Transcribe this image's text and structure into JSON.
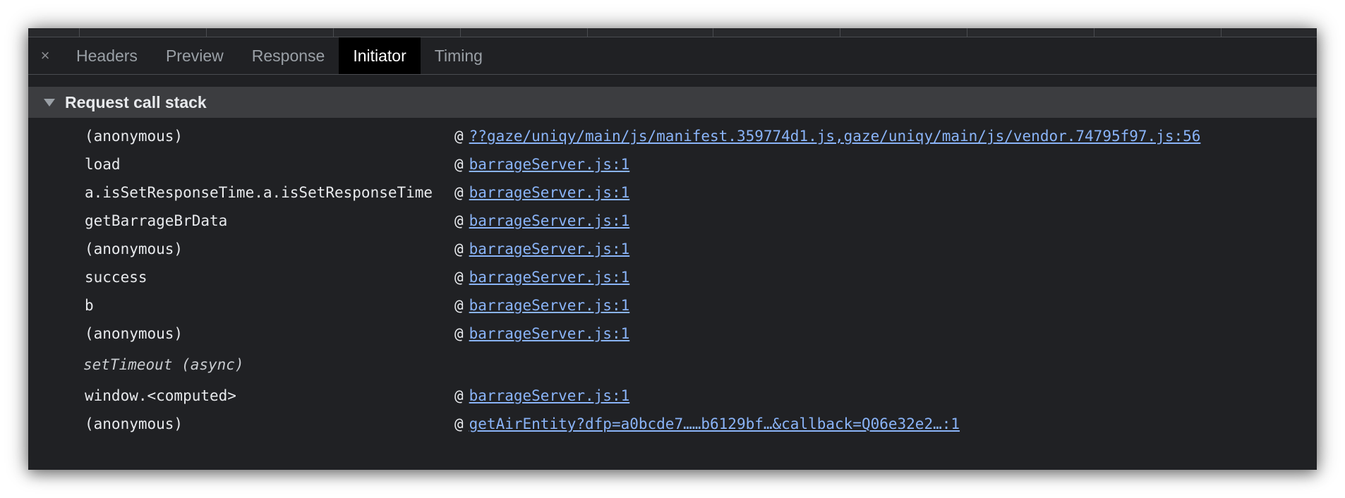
{
  "tabs": {
    "close_symbol": "×",
    "items": [
      {
        "label": "Headers",
        "active": false
      },
      {
        "label": "Preview",
        "active": false
      },
      {
        "label": "Response",
        "active": false
      },
      {
        "label": "Initiator",
        "active": true
      },
      {
        "label": "Timing",
        "active": false
      }
    ]
  },
  "section": {
    "title": "Request call stack",
    "expanded": true
  },
  "at_symbol": "@",
  "frames": [
    {
      "function": "(anonymous)",
      "location": "??gaze/uniqy/main/js/manifest.359774d1.js,gaze/uniqy/main/js/vendor.74795f97.js:56"
    },
    {
      "function": "load",
      "location": "barrageServer.js:1"
    },
    {
      "function": "a.isSetResponseTime.a.isSetResponseTime",
      "location": "barrageServer.js:1"
    },
    {
      "function": "getBarrageBrData",
      "location": "barrageServer.js:1"
    },
    {
      "function": "(anonymous)",
      "location": "barrageServer.js:1"
    },
    {
      "function": "success",
      "location": "barrageServer.js:1"
    },
    {
      "function": "b",
      "location": "barrageServer.js:1"
    },
    {
      "function": "(anonymous)",
      "location": "barrageServer.js:1"
    },
    {
      "async_label": "setTimeout (async)"
    },
    {
      "function": "window.<computed>",
      "location": "barrageServer.js:1"
    },
    {
      "function": "(anonymous)",
      "location": "getAirEntity?dfp=a0bcde7……b6129bf…&callback=Q06e32e2…:1"
    }
  ],
  "colors": {
    "panel_bg": "#202124",
    "section_header_bg": "#3c3d40",
    "link": "#8ab4f8",
    "active_tab_bg": "#000000"
  }
}
